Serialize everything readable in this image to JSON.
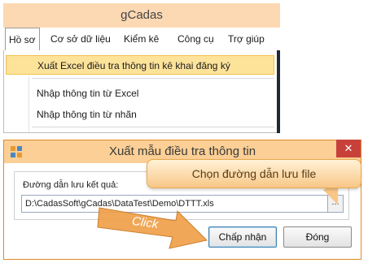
{
  "app": {
    "title": "gCadas",
    "menu": [
      "Hồ sơ",
      "Cơ sở dữ liệu",
      "Kiểm kê",
      "Công cụ",
      "Trợ giúp"
    ],
    "dropdown": [
      "Xuất Excel điều tra thông tin kê khai đăng ký",
      "Nhập thông tin từ Excel",
      "Nhập thông tin từ nhãn"
    ]
  },
  "dialog": {
    "title": "Xuất mẫu điều tra thông tin",
    "close_symbol": "✕",
    "path_label": "Đường dẫn lưu kết quả:",
    "path_value": "D:\\CadasSoft\\gCadas\\DataTest\\Demo\\DTTT.xls",
    "browse_label": "...",
    "accept_label": "Chấp nhận",
    "close_label": "Đóng"
  },
  "callouts": {
    "tooltip": "Chọn đường dẫn lưu file",
    "arrow": "Click"
  },
  "colors": {
    "title_bg": "#fcd9b3",
    "highlight": "#fde39a",
    "accent_orange": "#f0a04a"
  }
}
